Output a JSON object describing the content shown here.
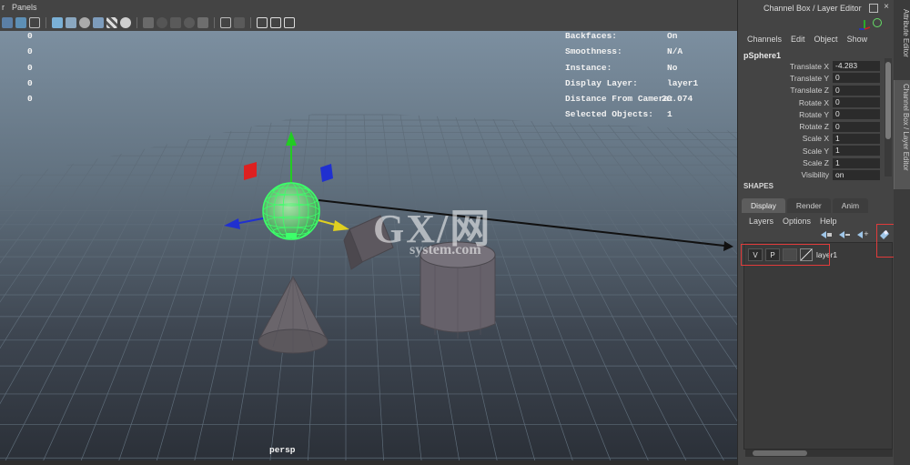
{
  "menubar": {
    "items": [
      "r",
      "Panels"
    ]
  },
  "hud_left": {
    "values": [
      "0",
      "0",
      "0",
      "0",
      "0"
    ]
  },
  "hud_right": {
    "rows": [
      {
        "label": "Backfaces:",
        "value": "On"
      },
      {
        "label": "Smoothness:",
        "value": "N/A"
      },
      {
        "label": "Instance:",
        "value": "No"
      },
      {
        "label": "Display Layer:",
        "value": "layer1"
      },
      {
        "label": "Distance From Camera:",
        "value": "20.074"
      },
      {
        "label": "Selected Objects:",
        "value": "1"
      }
    ]
  },
  "viewport": {
    "camera_label": "persp"
  },
  "watermark": {
    "main": "GX/网",
    "sub": "system.com"
  },
  "channel_box": {
    "title": "Channel Box / Layer Editor",
    "menus": [
      "Channels",
      "Edit",
      "Object",
      "Show"
    ],
    "object_name": "pSphere1",
    "channels": [
      {
        "name": "Translate X",
        "value": "-4.283"
      },
      {
        "name": "Translate Y",
        "value": "0"
      },
      {
        "name": "Translate Z",
        "value": "0"
      },
      {
        "name": "Rotate X",
        "value": "0"
      },
      {
        "name": "Rotate Y",
        "value": "0"
      },
      {
        "name": "Rotate Z",
        "value": "0"
      },
      {
        "name": "Scale X",
        "value": "1"
      },
      {
        "name": "Scale Y",
        "value": "1"
      },
      {
        "name": "Scale Z",
        "value": "1"
      },
      {
        "name": "Visibility",
        "value": "on"
      }
    ],
    "shapes_label": "SHAPES"
  },
  "side_tabs": {
    "attribute_editor": "Attribute Editor",
    "channel_box": "Channel Box / Layer Editor"
  },
  "layer_editor": {
    "tabs": [
      "Display",
      "Render",
      "Anim"
    ],
    "menus": [
      "Layers",
      "Options",
      "Help"
    ],
    "layer": {
      "visible": "V",
      "playback": "P",
      "name": "layer1"
    }
  },
  "colors": {
    "accent_highlight": "#e03b3b",
    "sphere_wire": "#3cff6a",
    "axis_y": "#22cc22",
    "axis_x": "#2030d0",
    "axis_z": "#e0d020",
    "handle_red": "#dd2020"
  }
}
